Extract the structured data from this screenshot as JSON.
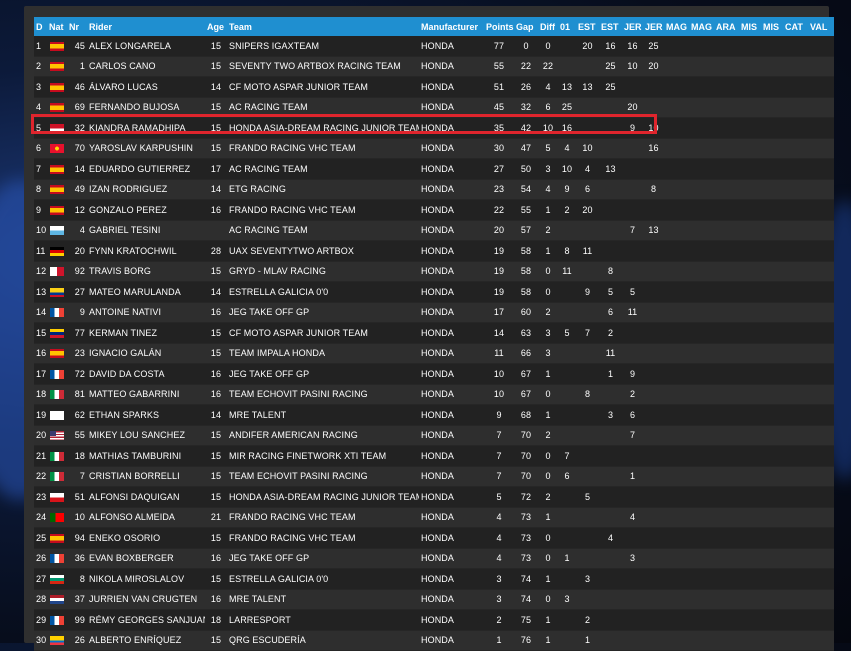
{
  "columns": [
    "D",
    "Nat",
    "Nr",
    "Rider",
    "Age",
    "Team",
    "Manufacturer",
    "Points",
    "Gap",
    "Diff",
    "01",
    "EST",
    "EST",
    "JER",
    "JER",
    "MAG",
    "MAG",
    "ARA",
    "MIS",
    "MIS",
    "CAT",
    "VAL"
  ],
  "colors": {
    "header": "#1f8fd0",
    "highlight": "#e0252d"
  },
  "rows": [
    {
      "pos": "1",
      "flag": "spain",
      "nr": "45",
      "rider": "ALEX LONGARELA",
      "age": "15",
      "team": "SNIPERS IGAXTEAM",
      "manu": "HONDA",
      "points": "77",
      "gap": "0",
      "diff": "0",
      "r": [
        "",
        "20",
        "16",
        "16",
        "25",
        "",
        "",
        "",
        "",
        "",
        "",
        ""
      ]
    },
    {
      "pos": "2",
      "flag": "spain",
      "nr": "1",
      "rider": "CARLOS CANO",
      "age": "15",
      "team": "SEVENTY TWO ARTBOX RACING TEAM",
      "manu": "HONDA",
      "points": "55",
      "gap": "22",
      "diff": "22",
      "r": [
        "",
        "",
        "25",
        "10",
        "20",
        "",
        "",
        "",
        "",
        "",
        "",
        ""
      ]
    },
    {
      "pos": "3",
      "flag": "spain",
      "nr": "46",
      "rider": "ÁLVARO LUCAS",
      "age": "14",
      "team": "CF MOTO ASPAR JUNIOR TEAM",
      "manu": "HONDA",
      "points": "51",
      "gap": "26",
      "diff": "4",
      "r": [
        "13",
        "13",
        "25",
        "",
        "",
        "",
        "",
        "",
        "",
        "",
        "",
        ""
      ]
    },
    {
      "pos": "4",
      "flag": "spain",
      "nr": "69",
      "rider": "FERNANDO BUJOSA",
      "age": "15",
      "team": "AC RACING TEAM",
      "manu": "HONDA",
      "points": "45",
      "gap": "32",
      "diff": "6",
      "r": [
        "25",
        "",
        "",
        "20",
        "",
        "",
        "",
        "",
        "",
        "",
        "",
        ""
      ]
    },
    {
      "pos": "5",
      "flag": "indonesia",
      "nr": "32",
      "rider": "KIANDRA RAMADHIPA",
      "age": "15",
      "team": "HONDA ASIA-DREAM RACING JUNIOR TEAM",
      "manu": "HONDA",
      "points": "35",
      "gap": "42",
      "diff": "10",
      "r": [
        "16",
        "",
        "",
        "9",
        "10",
        "",
        "",
        "",
        "",
        "",
        "",
        ""
      ]
    },
    {
      "pos": "6",
      "flag": "kyrgyzstan",
      "nr": "70",
      "rider": "YAROSLAV KARPUSHIN",
      "age": "15",
      "team": "FRANDO RACING VHC TEAM",
      "manu": "HONDA",
      "points": "30",
      "gap": "47",
      "diff": "5",
      "r": [
        "4",
        "10",
        "",
        "",
        "16",
        "",
        "",
        "",
        "",
        "",
        "",
        ""
      ]
    },
    {
      "pos": "7",
      "flag": "spain",
      "nr": "14",
      "rider": "EDUARDO GUTIERREZ",
      "age": "17",
      "team": "AC RACING TEAM",
      "manu": "HONDA",
      "points": "27",
      "gap": "50",
      "diff": "3",
      "r": [
        "10",
        "4",
        "13",
        "",
        "",
        "",
        "",
        "",
        "",
        "",
        "",
        ""
      ]
    },
    {
      "pos": "8",
      "flag": "spain",
      "nr": "49",
      "rider": "IZAN RODRIGUEZ",
      "age": "14",
      "team": "ETG RACING",
      "manu": "HONDA",
      "points": "23",
      "gap": "54",
      "diff": "4",
      "r": [
        "9",
        "6",
        "",
        "",
        "8",
        "",
        "",
        "",
        "",
        "",
        "",
        ""
      ]
    },
    {
      "pos": "9",
      "flag": "spain",
      "nr": "12",
      "rider": "GONZALO PEREZ",
      "age": "16",
      "team": "FRANDO RACING VHC TEAM",
      "manu": "HONDA",
      "points": "22",
      "gap": "55",
      "diff": "1",
      "r": [
        "2",
        "20",
        "",
        "",
        "",
        "",
        "",
        "",
        "",
        "",
        "",
        ""
      ]
    },
    {
      "pos": "10",
      "flag": "sanmarino",
      "nr": "4",
      "rider": "GABRIEL TESINI",
      "age": "",
      "team": "AC RACING TEAM",
      "manu": "HONDA",
      "points": "20",
      "gap": "57",
      "diff": "2",
      "r": [
        "",
        "",
        "",
        "7",
        "13",
        "",
        "",
        "",
        "",
        "",
        "",
        ""
      ]
    },
    {
      "pos": "11",
      "flag": "germany",
      "nr": "20",
      "rider": "FYNN KRATOCHWIL",
      "age": "28",
      "team": "UAX SEVENTYTWO ARTBOX",
      "manu": "HONDA",
      "points": "19",
      "gap": "58",
      "diff": "1",
      "r": [
        "8",
        "11",
        "",
        "",
        "",
        "",
        "",
        "",
        "",
        "",
        "",
        ""
      ]
    },
    {
      "pos": "12",
      "flag": "malta",
      "nr": "92",
      "rider": "TRAVIS BORG",
      "age": "15",
      "team": "GRYD - MLAV RACING",
      "manu": "HONDA",
      "points": "19",
      "gap": "58",
      "diff": "0",
      "r": [
        "11",
        "",
        "8",
        "",
        "",
        "",
        "",
        "",
        "",
        "",
        "",
        ""
      ]
    },
    {
      "pos": "13",
      "flag": "colombia",
      "nr": "27",
      "rider": "MATEO MARULANDA",
      "age": "14",
      "team": "ESTRELLA GALICIA 0'0",
      "manu": "HONDA",
      "points": "19",
      "gap": "58",
      "diff": "0",
      "r": [
        "",
        "9",
        "5",
        "5",
        "",
        "",
        "",
        "",
        "",
        "",
        "",
        ""
      ]
    },
    {
      "pos": "14",
      "flag": "france",
      "nr": "9",
      "rider": "ANTOINE NATIVI",
      "age": "16",
      "team": "JEG TAKE OFF GP",
      "manu": "HONDA",
      "points": "17",
      "gap": "60",
      "diff": "2",
      "r": [
        "",
        "",
        "6",
        "11",
        "",
        "",
        "",
        "",
        "",
        "",
        "",
        ""
      ]
    },
    {
      "pos": "15",
      "flag": "venezuela",
      "nr": "77",
      "rider": "KERMAN TINEZ",
      "age": "15",
      "team": "CF MOTO ASPAR JUNIOR TEAM",
      "manu": "HONDA",
      "points": "14",
      "gap": "63",
      "diff": "3",
      "r": [
        "5",
        "7",
        "2",
        "",
        "",
        "",
        "",
        "",
        "",
        "",
        "",
        ""
      ]
    },
    {
      "pos": "16",
      "flag": "spain",
      "nr": "23",
      "rider": "IGNACIO GALÁN",
      "age": "15",
      "team": "TEAM IMPALA HONDA",
      "manu": "HONDA",
      "points": "11",
      "gap": "66",
      "diff": "3",
      "r": [
        "",
        "",
        "11",
        "",
        "",
        "",
        "",
        "",
        "",
        "",
        "",
        ""
      ]
    },
    {
      "pos": "17",
      "flag": "france",
      "nr": "72",
      "rider": "DAVID DA COSTA",
      "age": "16",
      "team": "JEG TAKE OFF GP",
      "manu": "HONDA",
      "points": "10",
      "gap": "67",
      "diff": "1",
      "r": [
        "",
        "",
        "1",
        "9",
        "",
        "",
        "",
        "",
        "",
        "",
        "",
        ""
      ]
    },
    {
      "pos": "18",
      "flag": "italy",
      "nr": "81",
      "rider": "MATTEO GABARRINI",
      "age": "16",
      "team": "TEAM ECHOVIT PASINI RACING",
      "manu": "HONDA",
      "points": "10",
      "gap": "67",
      "diff": "0",
      "r": [
        "",
        "8",
        "",
        "2",
        "",
        "",
        "",
        "",
        "",
        "",
        "",
        ""
      ]
    },
    {
      "pos": "19",
      "flag": "uk",
      "nr": "62",
      "rider": "ETHAN SPARKS",
      "age": "14",
      "team": "MRE TALENT",
      "manu": "HONDA",
      "points": "9",
      "gap": "68",
      "diff": "1",
      "r": [
        "",
        "",
        "3",
        "6",
        "",
        "",
        "",
        "",
        "",
        "",
        "",
        ""
      ]
    },
    {
      "pos": "20",
      "flag": "usa",
      "nr": "55",
      "rider": "MIKEY LOU SANCHEZ",
      "age": "15",
      "team": "ANDIFER AMERICAN RACING",
      "manu": "HONDA",
      "points": "7",
      "gap": "70",
      "diff": "2",
      "r": [
        "",
        "",
        "",
        "7",
        "",
        "",
        "",
        "",
        "",
        "",
        "",
        ""
      ]
    },
    {
      "pos": "21",
      "flag": "italy",
      "nr": "18",
      "rider": "MATHIAS TAMBURINI",
      "age": "15",
      "team": "MIR RACING FINETWORK XTI TEAM",
      "manu": "HONDA",
      "points": "7",
      "gap": "70",
      "diff": "0",
      "r": [
        "7",
        "",
        "",
        "",
        "",
        "",
        "",
        "",
        "",
        "",
        "",
        ""
      ]
    },
    {
      "pos": "22",
      "flag": "italy",
      "nr": "7",
      "rider": "CRISTIAN BORRELLI",
      "age": "15",
      "team": "TEAM ECHOVIT PASINI RACING",
      "manu": "HONDA",
      "points": "7",
      "gap": "70",
      "diff": "0",
      "r": [
        "6",
        "",
        "",
        "1",
        "",
        "",
        "",
        "",
        "",
        "",
        "",
        ""
      ]
    },
    {
      "pos": "23",
      "flag": "czech",
      "nr": "51",
      "rider": "ALFONSI DAQUIGAN",
      "age": "15",
      "team": "HONDA ASIA-DREAM RACING JUNIOR TEAM",
      "manu": "HONDA",
      "points": "5",
      "gap": "72",
      "diff": "2",
      "r": [
        "",
        "5",
        "",
        "",
        "",
        "",
        "",
        "",
        "",
        "",
        "",
        ""
      ]
    },
    {
      "pos": "24",
      "flag": "portugal",
      "nr": "10",
      "rider": "ALFONSO ALMEIDA",
      "age": "21",
      "team": "FRANDO RACING VHC TEAM",
      "manu": "HONDA",
      "points": "4",
      "gap": "73",
      "diff": "1",
      "r": [
        "",
        "",
        "",
        "4",
        "",
        "",
        "",
        "",
        "",
        "",
        "",
        ""
      ]
    },
    {
      "pos": "25",
      "flag": "spain",
      "nr": "94",
      "rider": "ENEKO OSORIO",
      "age": "15",
      "team": "FRANDO RACING VHC TEAM",
      "manu": "HONDA",
      "points": "4",
      "gap": "73",
      "diff": "0",
      "r": [
        "",
        "",
        "4",
        "",
        "",
        "",
        "",
        "",
        "",
        "",
        "",
        ""
      ]
    },
    {
      "pos": "26",
      "flag": "france",
      "nr": "36",
      "rider": "EVAN BOXBERGER",
      "age": "16",
      "team": "JEG TAKE OFF GP",
      "manu": "HONDA",
      "points": "4",
      "gap": "73",
      "diff": "0",
      "r": [
        "1",
        "",
        "",
        "3",
        "",
        "",
        "",
        "",
        "",
        "",
        "",
        ""
      ]
    },
    {
      "pos": "27",
      "flag": "bulgaria",
      "nr": "8",
      "rider": "NIKOLA MIROSLALOV",
      "age": "15",
      "team": "ESTRELLA GALICIA 0'0",
      "manu": "HONDA",
      "points": "3",
      "gap": "74",
      "diff": "1",
      "r": [
        "",
        "3",
        "",
        "",
        "",
        "",
        "",
        "",
        "",
        "",
        "",
        ""
      ]
    },
    {
      "pos": "28",
      "flag": "netherlands",
      "nr": "37",
      "rider": "JURRIEN VAN CRUGTEN",
      "age": "16",
      "team": "MRE TALENT",
      "manu": "HONDA",
      "points": "3",
      "gap": "74",
      "diff": "0",
      "r": [
        "3",
        "",
        "",
        "",
        "",
        "",
        "",
        "",
        "",
        "",
        "",
        ""
      ]
    },
    {
      "pos": "29",
      "flag": "france",
      "nr": "99",
      "rider": "RÉMY GEORGES SANJUAN",
      "age": "18",
      "team": "LARRESPORT",
      "manu": "HONDA",
      "points": "2",
      "gap": "75",
      "diff": "1",
      "r": [
        "",
        "2",
        "",
        "",
        "",
        "",
        "",
        "",
        "",
        "",
        "",
        ""
      ]
    },
    {
      "pos": "30",
      "flag": "ecuador",
      "nr": "26",
      "rider": "ALBERTO ENRÍQUEZ",
      "age": "15",
      "team": "QRG ESCUDERÍA",
      "manu": "HONDA",
      "points": "1",
      "gap": "76",
      "diff": "1",
      "r": [
        "",
        "1",
        "",
        "",
        "",
        "",
        "",
        "",
        "",
        "",
        "",
        ""
      ]
    }
  ]
}
